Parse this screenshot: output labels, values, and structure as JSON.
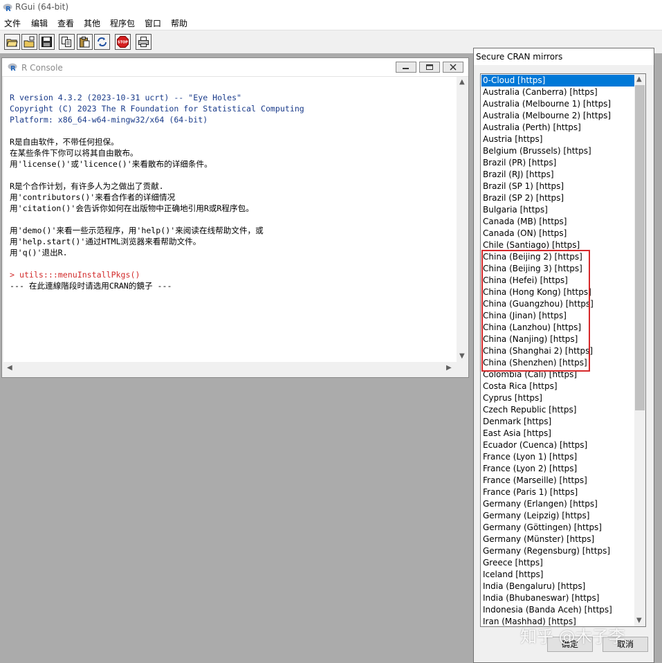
{
  "app": {
    "title": "RGui (64-bit)"
  },
  "menu": [
    "文件",
    "编辑",
    "查看",
    "其他",
    "程序包",
    "窗口",
    "帮助"
  ],
  "toolbar_icons": [
    "open-script-icon",
    "load-workspace-icon",
    "save-icon",
    "copy-icon",
    "paste-icon",
    "copy-paste-icon",
    "stop-icon",
    "print-icon"
  ],
  "stop_label": "STOP",
  "console": {
    "title": "R Console",
    "lines": [
      {
        "text": "R version 4.3.2 (2023-10-31 ucrt) -- \"Eye Holes\"",
        "style": "blue"
      },
      {
        "text": "Copyright (C) 2023 The R Foundation for Statistical Computing",
        "style": "blue"
      },
      {
        "text": "Platform: x86_64-w64-mingw32/x64 (64-bit)",
        "style": "blue"
      },
      {
        "text": "R是自由软件，不带任何担保。",
        "style": "out"
      },
      {
        "text": "在某些条件下你可以将其自由散布。",
        "style": "out"
      },
      {
        "text": "用'license()'或'licence()'来看散布的详细条件。",
        "style": "out"
      },
      {
        "text": "R是个合作计划，有许多人为之做出了贡献.",
        "style": "out"
      },
      {
        "text": "用'contributors()'来看合作者的详细情况",
        "style": "out"
      },
      {
        "text": "用'citation()'会告诉你如何在出版物中正确地引用R或R程序包。",
        "style": "out"
      },
      {
        "text": "用'demo()'来看一些示范程序，用'help()'来阅读在线帮助文件，或",
        "style": "out"
      },
      {
        "text": "用'help.start()'通过HTML浏览器来看帮助文件。",
        "style": "out"
      },
      {
        "text": "用'q()'退出R.",
        "style": "out"
      },
      {
        "text": "> utils:::menuInstallPkgs()",
        "style": "red"
      },
      {
        "text": "--- 在此連線階段时请选用CRAN的鏡子 ---",
        "style": "out"
      }
    ]
  },
  "dialog": {
    "title": "Secure CRAN mirrors",
    "selected_index": 0,
    "mirrors": [
      "0-Cloud [https]",
      "Australia (Canberra) [https]",
      "Australia (Melbourne 1) [https]",
      "Australia (Melbourne 2) [https]",
      "Australia (Perth) [https]",
      "Austria [https]",
      "Belgium (Brussels) [https]",
      "Brazil (PR) [https]",
      "Brazil (RJ) [https]",
      "Brazil (SP 1) [https]",
      "Brazil (SP 2) [https]",
      "Bulgaria [https]",
      "Canada (MB) [https]",
      "Canada (ON) [https]",
      "Chile (Santiago) [https]",
      "China (Beijing 2) [https]",
      "China (Beijing 3) [https]",
      "China (Hefei) [https]",
      "China (Hong Kong) [https]",
      "China (Guangzhou) [https]",
      "China (Jinan) [https]",
      "China (Lanzhou) [https]",
      "China (Nanjing) [https]",
      "China (Shanghai 2) [https]",
      "China (Shenzhen) [https]",
      "Colombia (Cali) [https]",
      "Costa Rica [https]",
      "Cyprus [https]",
      "Czech Republic [https]",
      "Denmark [https]",
      "East Asia [https]",
      "Ecuador (Cuenca) [https]",
      "France (Lyon 1) [https]",
      "France (Lyon 2) [https]",
      "France (Marseille) [https]",
      "France (Paris 1) [https]",
      "Germany (Erlangen) [https]",
      "Germany (Leipzig) [https]",
      "Germany (Göttingen) [https]",
      "Germany (Münster) [https]",
      "Germany (Regensburg) [https]",
      "Greece [https]",
      "Iceland [https]",
      "India (Bengaluru) [https]",
      "India (Bhubaneswar) [https]",
      "Indonesia (Banda Aceh) [https]",
      "Iran (Mashhad) [https]"
    ],
    "ok_label": "确定",
    "cancel_label": "取消"
  },
  "colors": {
    "selection": "#0078d7",
    "highlight": "#d6282a",
    "console_blue": "#1a3b8a",
    "console_red": "#d22a2a"
  },
  "watermark": "知乎 @木子李"
}
